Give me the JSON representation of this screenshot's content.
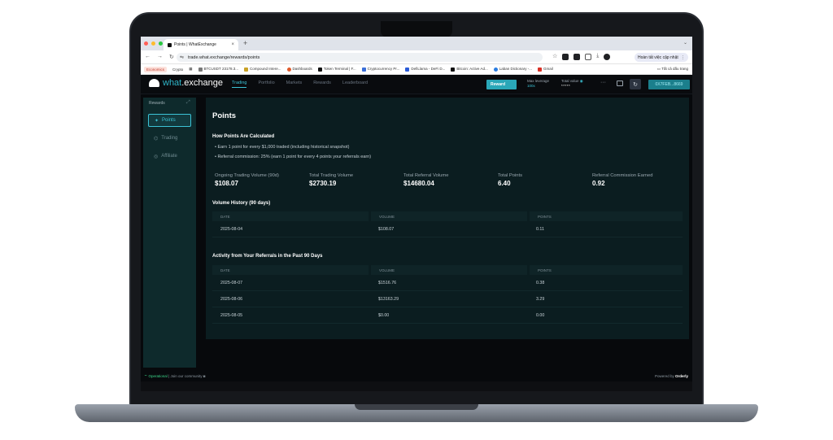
{
  "browser": {
    "tab_title": "Points | WhatExchange",
    "tab_close": "×",
    "new_tab": "+",
    "url": "trade.what.exchange/rewards/points",
    "update_button": "Hoàn tất việc cập nhật",
    "bookmarks": [
      {
        "label": "Economics",
        "highlight": true
      },
      {
        "label": "Crypto"
      },
      {
        "label": "BTCUSDT 23178.3..."
      },
      {
        "label": "Compound Intere..."
      },
      {
        "label": "Dashboards"
      },
      {
        "label": "Token Terminal | F..."
      },
      {
        "label": "Cryptocurrency Pr..."
      },
      {
        "label": "DefiLlama - DeFi D..."
      },
      {
        "label": "Bitcoin: Active Ad..."
      },
      {
        "label": "Laban Dictionary -..."
      },
      {
        "label": "Gmail"
      }
    ],
    "bookmarks_right": "Tất cả dấu trang"
  },
  "nav": {
    "logo_prefix": "what",
    "logo_suffix": ".exchange",
    "links": [
      "Trading",
      "Portfolio",
      "Markets",
      "Rewards",
      "Leaderboard"
    ],
    "reward_button": "Reward",
    "max_leverage_label": "Max leverage",
    "max_leverage_value": "100x",
    "total_value_label": "Total value",
    "total_value_value": "*****",
    "more": "···",
    "wallet": "0X7FEB...8669"
  },
  "sidebar": {
    "title": "Rewards",
    "items": [
      {
        "label": "Points",
        "active": true
      },
      {
        "label": "Trading"
      },
      {
        "label": "Affiliate"
      }
    ]
  },
  "main": {
    "title": "Points",
    "calc_title": "How Points Are Calculated",
    "rules": [
      "• Earn 1 point for every $1,000 traded (including historical snapshot)",
      "• Referral commission: 25% (earn 1 point for every 4 points your referrals earn)"
    ],
    "stats": [
      {
        "label": "Ongoing Trading Volume (90d)",
        "value": "$108.07"
      },
      {
        "label": "Total Trading Volume",
        "value": "$2730.19"
      },
      {
        "label": "Total Referral Volume",
        "value": "$14680.04"
      },
      {
        "label": "Total Points",
        "value": "6.40"
      },
      {
        "label": "Referral Commission Earned",
        "value": "0.92"
      }
    ],
    "volume_history": {
      "title": "Volume History (90 days)",
      "columns": [
        "DATE",
        "VOLUME",
        "POINTS"
      ],
      "rows": [
        [
          "2025-08-04",
          "$108.07",
          "0.11"
        ]
      ]
    },
    "referral_activity": {
      "title": "Activity from Your Referrals in the Past 90 Days",
      "columns": [
        "DATE",
        "VOLUME",
        "POINTS"
      ],
      "rows": [
        [
          "2025-08-07",
          "$1516.76",
          "0.38"
        ],
        [
          "2025-08-06",
          "$13163.29",
          "3.29"
        ],
        [
          "2025-08-05",
          "$0.00",
          "0.00"
        ]
      ]
    }
  },
  "footer": {
    "status": "Operational",
    "community": "Join our community",
    "powered_by": "Powered by",
    "powered_brand": "Orderly"
  }
}
